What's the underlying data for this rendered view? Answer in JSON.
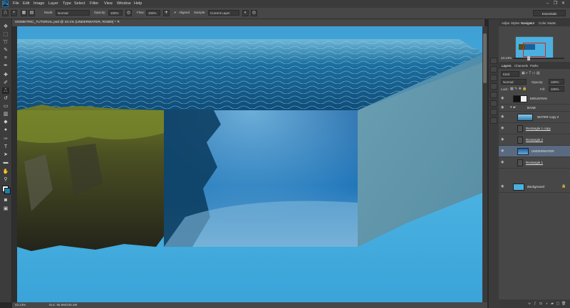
{
  "app": {
    "logo": "Ps"
  },
  "menu": [
    "File",
    "Edit",
    "Image",
    "Layer",
    "Type",
    "Select",
    "Filter",
    "View",
    "Window",
    "Help"
  ],
  "window_controls": [
    "–",
    "❐",
    "✕"
  ],
  "options": {
    "mode_label": "Mode:",
    "mode_value": "Normal",
    "opacity_label": "Opacity:",
    "opacity_value": "100%",
    "flow_label": "Flow:",
    "flow_value": "100%",
    "aligned_label": "Aligned",
    "sample_label": "Sample:",
    "sample_value": "Current Layer",
    "workspace": "Essentials"
  },
  "document": {
    "tab_title": "ISOMETRIC_TUTORIAL.psd @ 43.1% (UNDERWATER, RGB/8) *  ✕"
  },
  "status": {
    "zoom": "43.13%",
    "doc": "Doc: 95.8M/226.4M"
  },
  "panels": {
    "top_tabs": [
      "Adjus",
      "Styles",
      "Navigator",
      "Color",
      "Swatc"
    ],
    "active_top_tab": "Navigator",
    "nav_zoom": "43.13%",
    "layer_tabs": [
      "Layers",
      "Channels",
      "Paths"
    ],
    "kind_label": "Kind",
    "blend_mode": "Normal",
    "opacity_label": "Opacity:",
    "opacity_value": "100%",
    "lock_label": "Lock:",
    "fill_label": "Fill:",
    "fill_value": "100%"
  },
  "layers": [
    {
      "name": "MOUNTAIN",
      "selected": false,
      "underline": false
    },
    {
      "name": "BASE",
      "selected": false,
      "underline": false,
      "group": true
    },
    {
      "name": "WATER copy 2",
      "selected": false,
      "underline": false
    },
    {
      "name": "Rectangle 1 copy",
      "selected": false,
      "underline": true
    },
    {
      "name": "Rectangle 2",
      "selected": false,
      "underline": true
    },
    {
      "name": "UNDERWATER",
      "selected": true,
      "underline": false
    },
    {
      "name": "Rectangle 1",
      "selected": false,
      "underline": true
    },
    {
      "name": "Background",
      "selected": false,
      "underline": false
    }
  ],
  "colors": {
    "canvas_blue": "#4cb3e2",
    "side_face": "#5f94a8",
    "selection": "#596a80"
  },
  "icons": [
    "ps-logo",
    "move-icon",
    "marquee-icon",
    "lasso-icon",
    "quick-select-icon",
    "crop-icon",
    "eyedropper-icon",
    "healing-icon",
    "brush-icon",
    "clone-stamp-icon",
    "history-brush-icon",
    "eraser-icon",
    "gradient-icon",
    "blur-icon",
    "dodge-icon",
    "pen-icon",
    "type-icon",
    "path-select-icon",
    "shape-icon",
    "hand-icon",
    "zoom-icon",
    "color-swatch-icon",
    "quickmask-icon",
    "screenmode-icon",
    "eye-icon",
    "lock-icon",
    "link-icon",
    "fx-icon",
    "mask-icon",
    "adjustment-icon",
    "folder-icon",
    "new-layer-icon",
    "trash-icon"
  ]
}
